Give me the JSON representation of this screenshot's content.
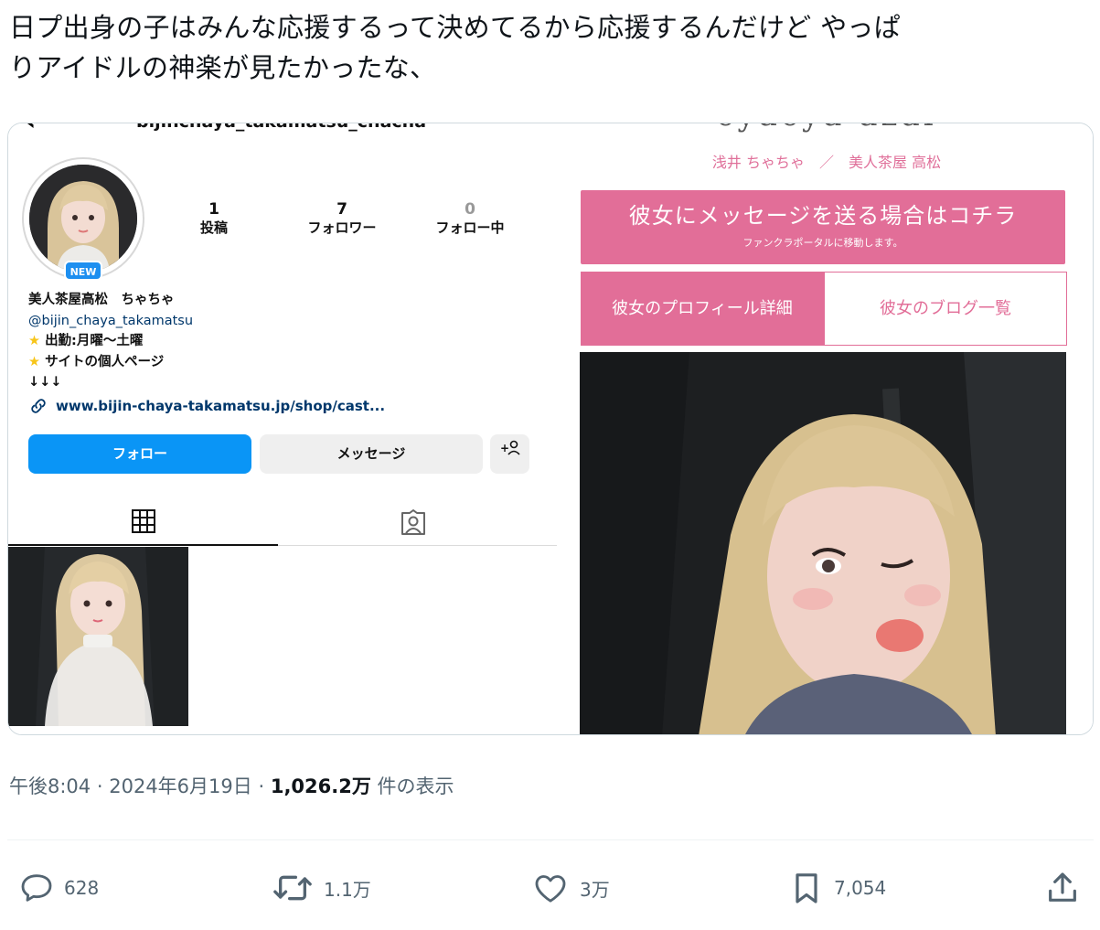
{
  "tweet": {
    "text_line1": "日プ出身の子はみんな応援するって決めてるから応援するんだけど やっぱ",
    "text_line2": "りアイドルの神楽が見たかったな、"
  },
  "instagram": {
    "top_handle": "bijinchaya_takamatsu_chacha",
    "new_badge": "NEW",
    "stats": [
      {
        "num": "1",
        "label": "投稿"
      },
      {
        "num": "7",
        "label": "フォロワー"
      },
      {
        "num": "0",
        "label": "フォロー中"
      }
    ],
    "bio_name": "美人茶屋高松　ちゃちゃ",
    "bio_handle": "@bijin_chaya_takamatsu",
    "bio_line1": "出勤:月曜〜土曜",
    "bio_line2": "サイトの個人ページ",
    "bio_line3": "↓↓↓",
    "link": "www.bijin-chaya-takamatsu.jp/shop/cast...",
    "follow_label": "フォロー",
    "message_label": "メッセージ",
    "add_label": "+"
  },
  "shop": {
    "brand": "cyacya azai",
    "cast_name": "浅井 ちゃちゃ　／　美人茶屋 高松",
    "message_main": "彼女にメッセージを送る場合はコチラ",
    "message_sub": "ファンクラポータルに移動します。",
    "profile_label": "彼女のプロフィール詳細",
    "blog_label": "彼女のブログ一覧"
  },
  "meta": {
    "time": "午後8:04",
    "sep": "·",
    "date": "2024年6月19日",
    "views": "1,026.2万",
    "views_suffix": "件の表示"
  },
  "actions": {
    "replies": "628",
    "retweets": "1.1万",
    "likes": "3万",
    "bookmarks": "7,054"
  }
}
